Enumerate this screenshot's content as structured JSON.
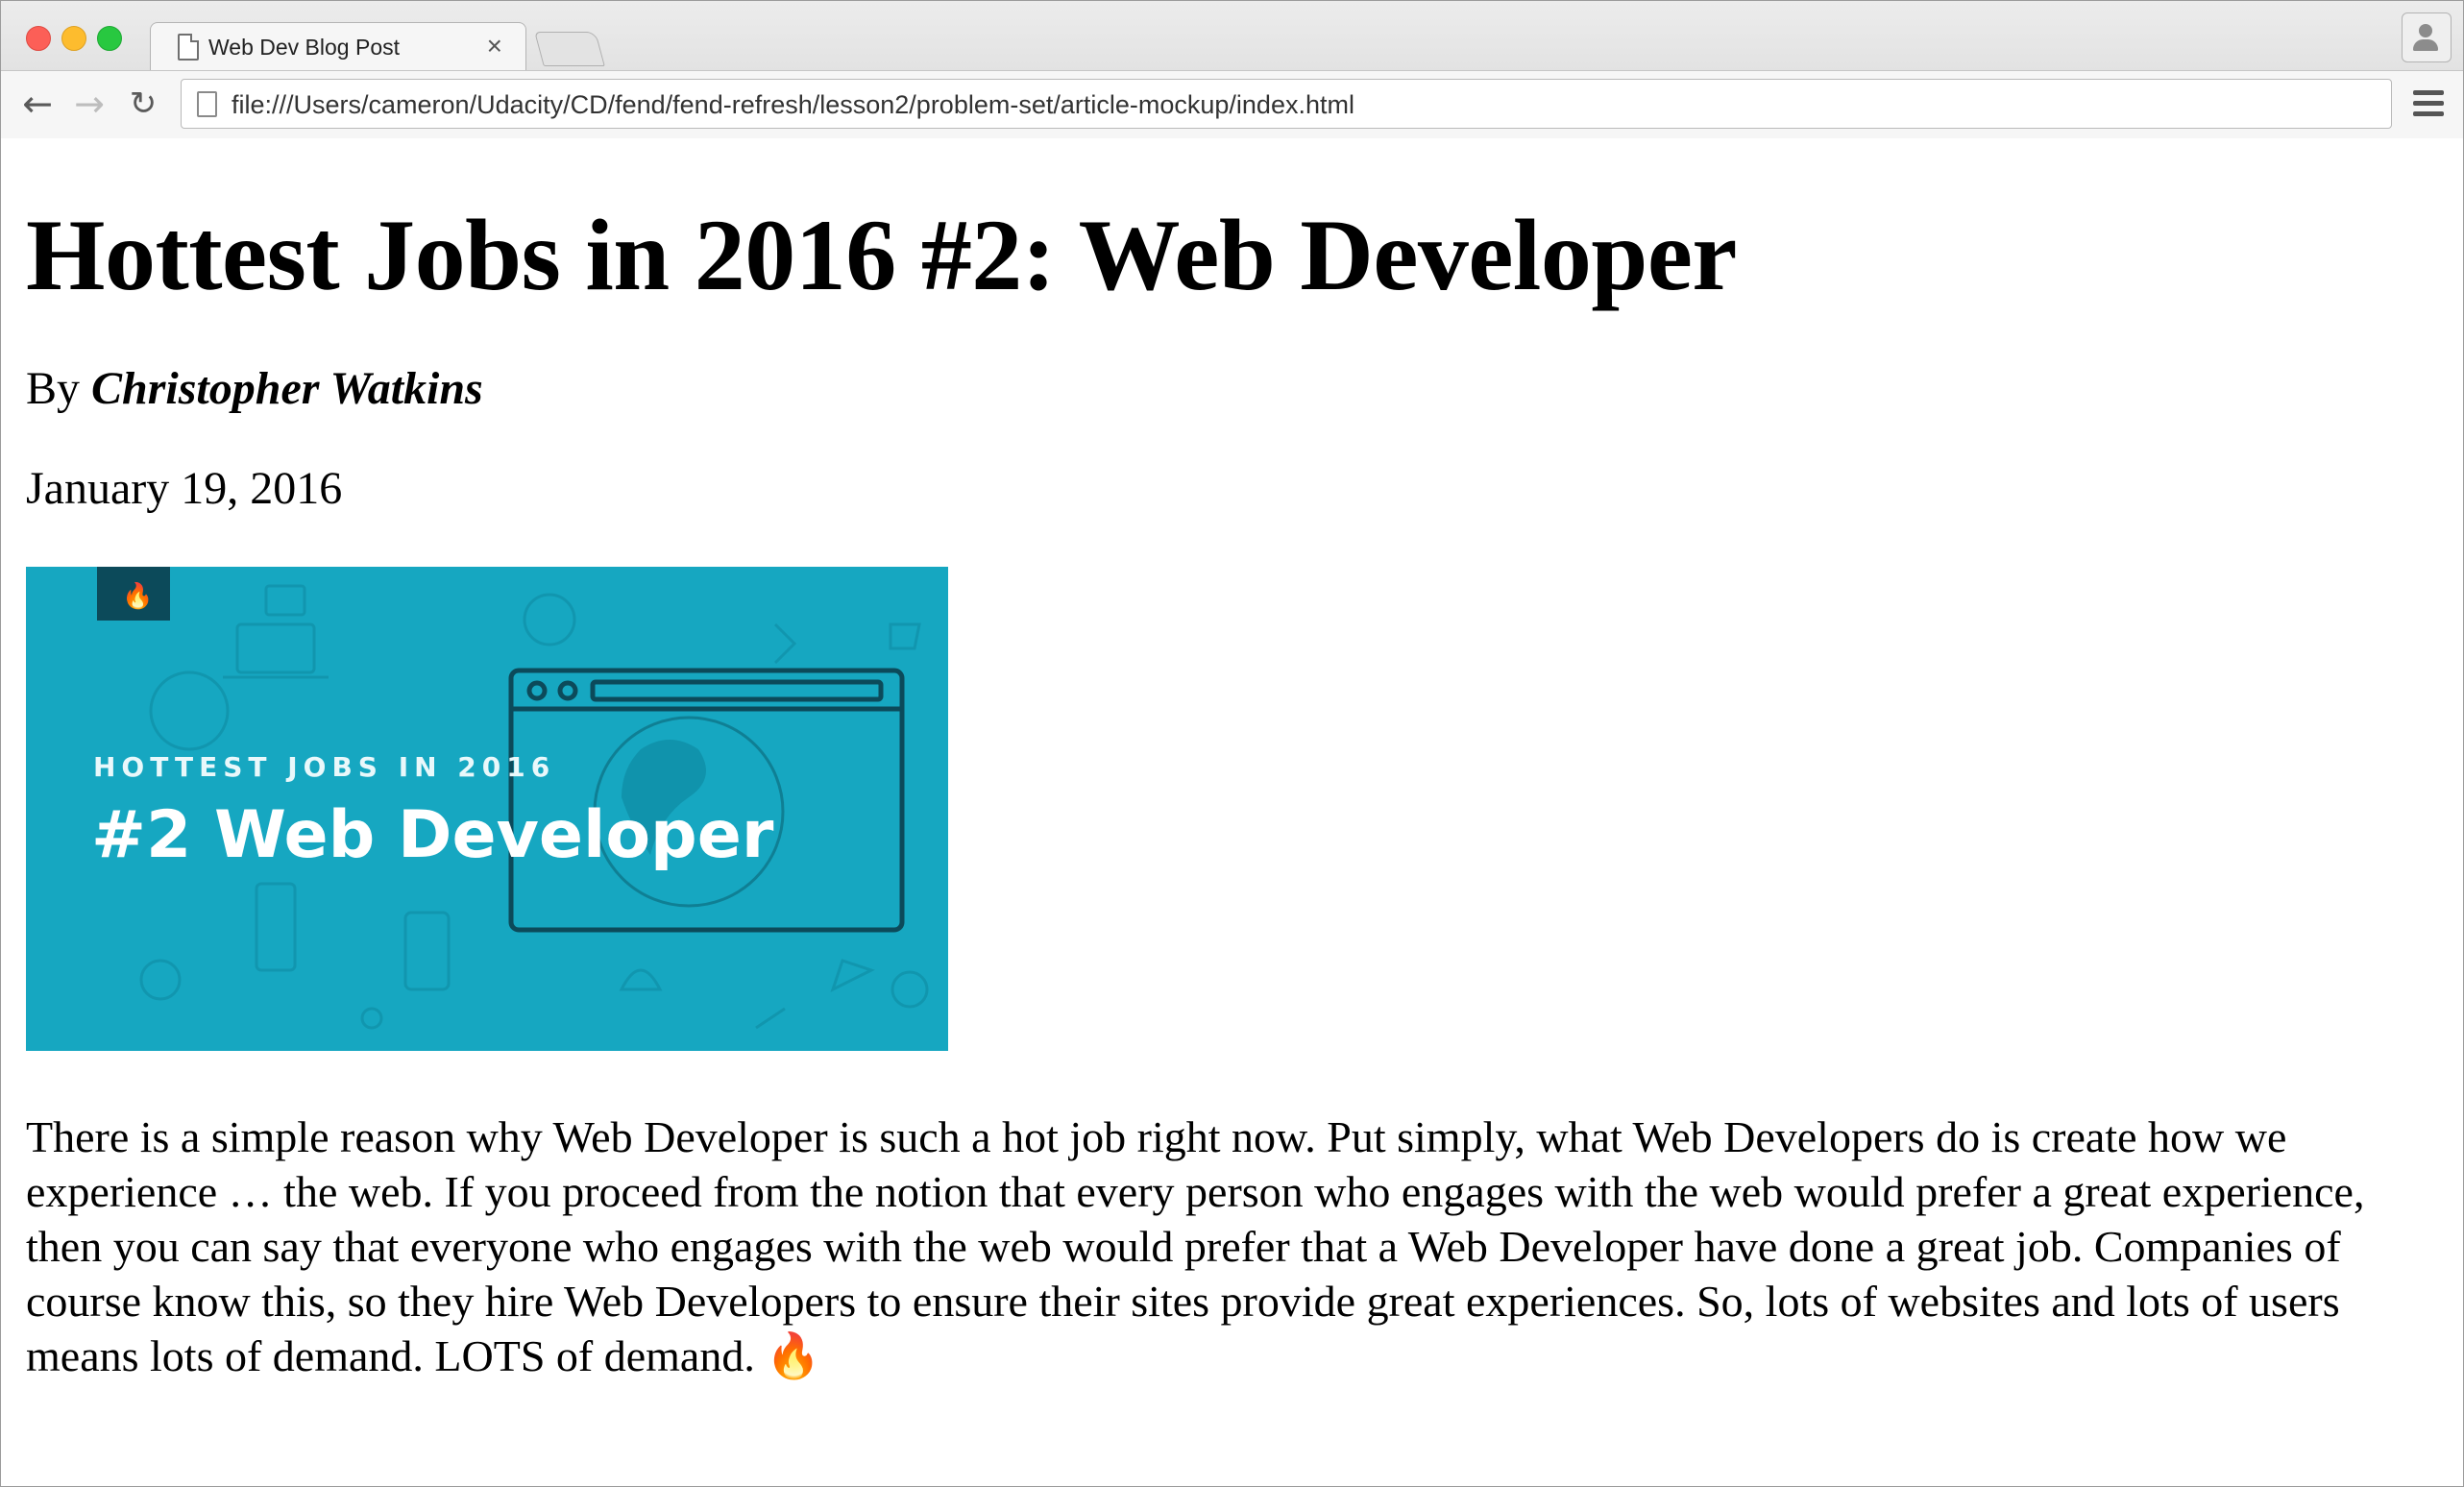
{
  "browser": {
    "tab_title": "Web Dev Blog Post",
    "tab_close": "×",
    "url": "file:///Users/cameron/Udacity/CD/fend/fend-refresh/lesson2/problem-set/article-mockup/index.html",
    "back": "←",
    "forward": "→",
    "reload": "↻"
  },
  "article": {
    "title": "Hottest Jobs in 2016 #2: Web Developer",
    "byline_prefix": "By",
    "author": "Christopher Watkins",
    "date": "January 19, 2016",
    "hero": {
      "kicker": "HOTTEST JOBS IN 2016",
      "headline": "#2 Web Developer",
      "badge_icon": "flame-icon",
      "background_color": "#16a7c1"
    },
    "body": "There is a simple reason why Web Developer is such a hot job right now. Put simply, what Web Developers do is create how we experience … the web. If you proceed from the notion that every person who engages with the web would prefer a great experience, then you can say that everyone who engages with the web would prefer that a Web Developer have done a great job. Companies of course know this, so they hire Web Developers to ensure their sites provide great experiences. So, lots of websites and lots of users means lots of demand. LOTS of demand. 🔥"
  }
}
